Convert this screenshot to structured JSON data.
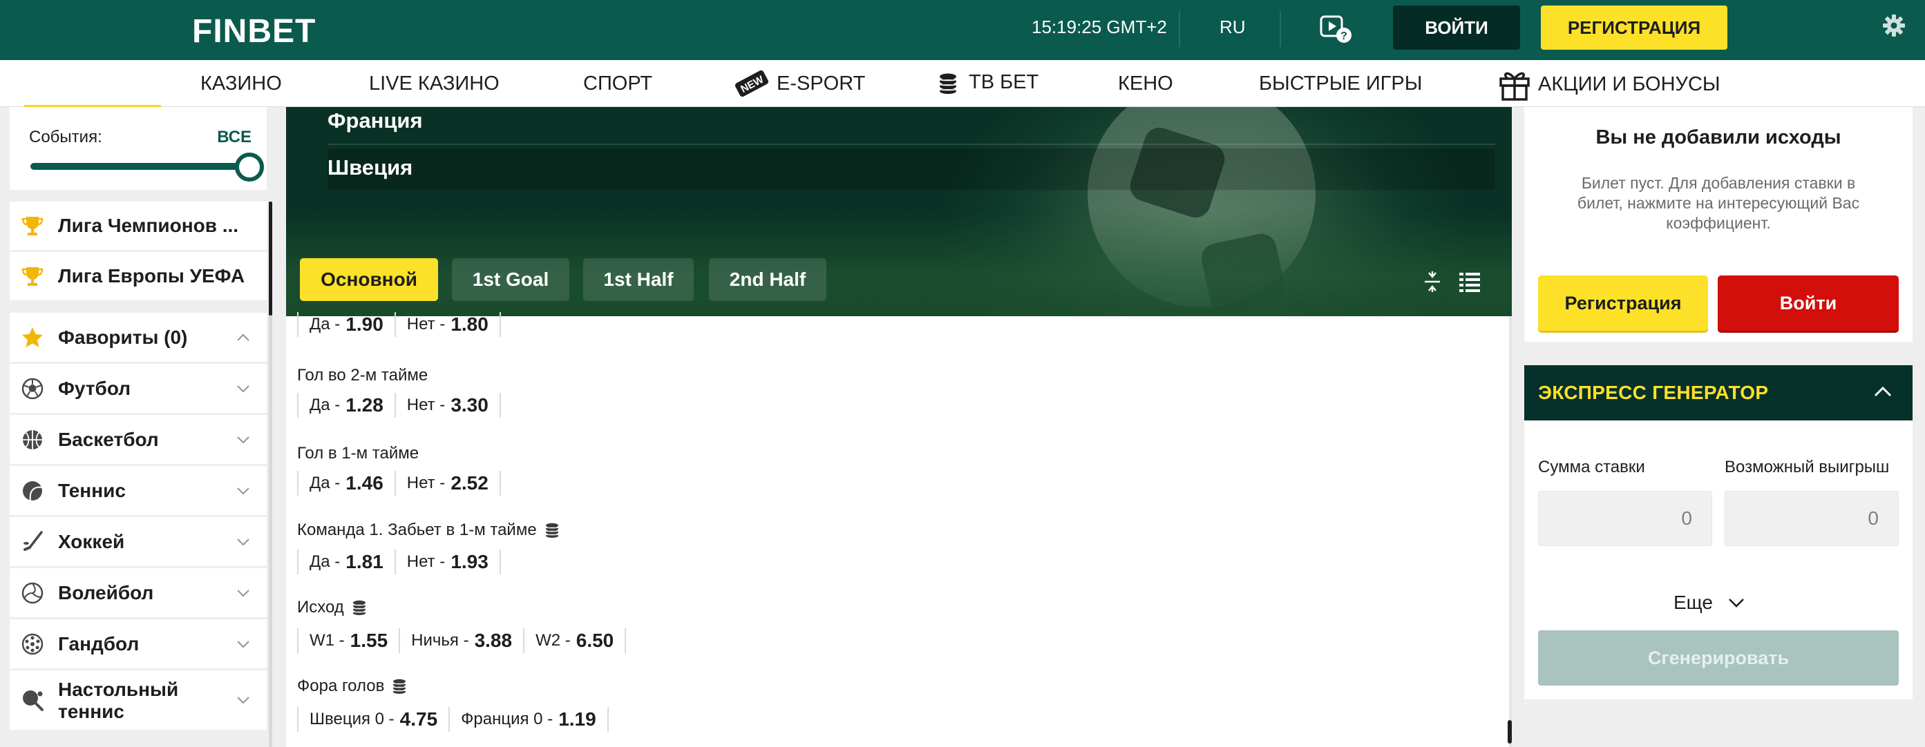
{
  "header": {
    "logo": "FINBET",
    "clock": "15:19:25 GMT+2",
    "lang": "RU",
    "login": "ВОЙТИ",
    "register": "РЕГИСТРАЦИЯ"
  },
  "nav": {
    "casino": "КАЗИНО",
    "live_casino": "LIVE КАЗИНО",
    "sport": "СПОРТ",
    "esport_badge": "NEW",
    "esport": "E-SPORT",
    "tv_bet": "ТВ БЕТ",
    "keno": "КЕНО",
    "fast_games": "БЫСТРЫЕ ИГРЫ",
    "promo": "АКЦИИ И БОНУСЫ"
  },
  "sidebar": {
    "events_label": "События:",
    "events_all": "ВСЕ",
    "leagues": [
      {
        "label": "Лига Чемпионов ..."
      },
      {
        "label": "Лига Европы УЕФА"
      }
    ],
    "favorites": "Фавориты (0)",
    "sports": [
      {
        "label": "Футбол",
        "icon": "soccer-ball-icon"
      },
      {
        "label": "Баскетбол",
        "icon": "basketball-icon"
      },
      {
        "label": "Теннис",
        "icon": "tennis-ball-icon"
      },
      {
        "label": "Хоккей",
        "icon": "hockey-stick-icon"
      },
      {
        "label": "Волейбол",
        "icon": "volleyball-icon"
      },
      {
        "label": "Гандбол",
        "icon": "handball-icon"
      },
      {
        "label_line1": "Настольный",
        "label_line2": "теннис",
        "icon": "table-tennis-icon"
      }
    ]
  },
  "match": {
    "team1": "Франция",
    "team2": "Швеция",
    "tabs": [
      "Основной",
      "1st Goal",
      "1st Half",
      "2nd Half"
    ]
  },
  "markets": {
    "m0": {
      "o1n": "Да -",
      "o1v": "1.90",
      "o2n": "Нет -",
      "o2v": "1.80"
    },
    "m1": {
      "title": "Гол во 2-м тайме",
      "o1n": "Да -",
      "o1v": "1.28",
      "o2n": "Нет -",
      "o2v": "3.30"
    },
    "m2": {
      "title": "Гол в 1-м тайме",
      "o1n": "Да -",
      "o1v": "1.46",
      "o2n": "Нет -",
      "o2v": "2.52"
    },
    "m3": {
      "title": "Команда 1. Забьет в 1-м тайме",
      "o1n": "Да -",
      "o1v": "1.81",
      "o2n": "Нет -",
      "o2v": "1.93"
    },
    "m4": {
      "title": "Исход",
      "o1n": "W1 -",
      "o1v": "1.55",
      "o2n": "Ничья -",
      "o2v": "3.88",
      "o3n": "W2 -",
      "o3v": "6.50"
    },
    "m5": {
      "title": "Фора голов",
      "o1n": "Швеция 0 -",
      "o1v": "4.75",
      "o2n": "Франция 0 -",
      "o2v": "1.19"
    }
  },
  "ticket": {
    "title": "Вы не добавили исходы",
    "text": "Билет пуст. Для добавления ставки в билет, нажмите на интересующий Вас коэффициент.",
    "register": "Регистрация",
    "login": "Войти"
  },
  "express": {
    "title": "ЭКСПРЕСС ГЕНЕРАТОР",
    "stake_label": "Сумма ставки",
    "win_label": "Возможный выигрыш",
    "stake_value": "0",
    "win_value": "0",
    "more": "Еще",
    "generate": "Сгенерировать"
  },
  "colors": {
    "brand_green": "#0b5a4e",
    "dark_green": "#042b26",
    "accent_yellow": "#fde128",
    "login_red": "#d20f0b"
  }
}
